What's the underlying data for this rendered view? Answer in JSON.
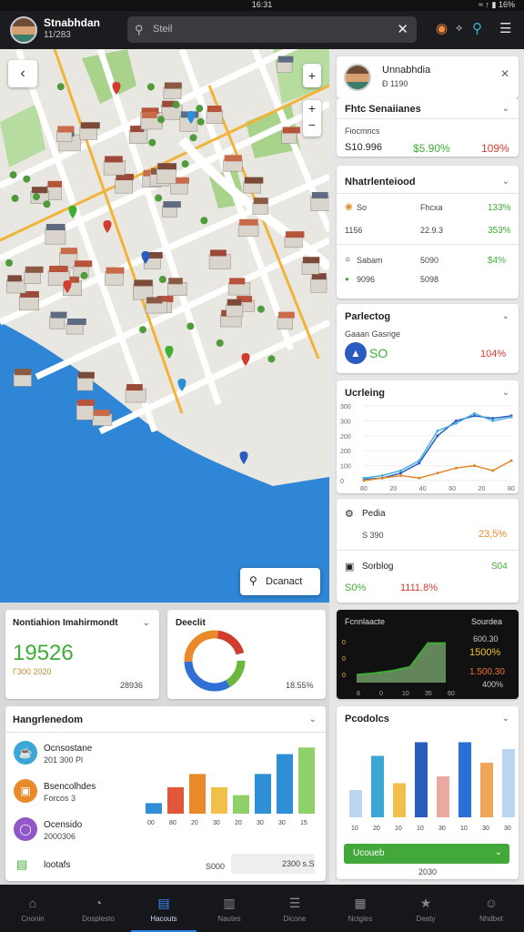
{
  "status_bar": {
    "time": "16:31",
    "icons": "≈ ↑ ▮ 16%"
  },
  "header": {
    "user_name": "Stnabhdan",
    "user_sub": "11/283",
    "search_placeholder": "Steil",
    "icons": [
      "alert-icon",
      "share-icon",
      "search-icon",
      "menu-icon"
    ]
  },
  "map": {
    "discover_label": "Dcanact",
    "zoom_in": "+",
    "zoom_out": "−",
    "layers": "+"
  },
  "profile_card": {
    "name": "Unnabhdia",
    "sub": "Ð 1190"
  },
  "stats_card": {
    "title": "Fhtc Senaiianes",
    "sub": "Fiocmncs",
    "v1": "S10.996",
    "v2": "$5.90%",
    "v3": "109%"
  },
  "notifications_card": {
    "title": "Nhatrlenteiood",
    "rows": [
      {
        "a": "So",
        "b": "Fhcxa",
        "c": "133%"
      },
      {
        "a": "1156",
        "b": "22.9.3",
        "c": "353%"
      },
      {
        "a": "Sabam",
        "b": "5090",
        "c": "$4%"
      },
      {
        "a": "9096",
        "b": "5098",
        "c": ""
      }
    ]
  },
  "parking_card": {
    "title": "Parlectog",
    "sub": "Gaaan Gasrige",
    "value": "SO",
    "pct": "104%"
  },
  "trending_card": {
    "title": "Ucrleing",
    "y_ticks": [
      "300",
      "300",
      "200",
      "200",
      "100",
      "0"
    ],
    "x_ticks": [
      "80",
      "20",
      "40",
      "60",
      "20",
      "80"
    ]
  },
  "finance_card": {
    "item1": "Pedia",
    "item1_value": "S 390",
    "item1_pct": "23,5%",
    "item2": "Sorblog",
    "item2_value": "S04",
    "row_a": "S0%",
    "row_b": "1111.8%"
  },
  "progress_card": {
    "title": "Fcnnlaacte",
    "right_title": "Sourdea",
    "values": [
      "600.30",
      "1500%",
      "1.500.30",
      "400%"
    ],
    "x_ticks": [
      "8",
      "0",
      "10",
      "35",
      "60"
    ]
  },
  "summary_card": {
    "title": "Nontiahion Imahirmondt",
    "value": "19526",
    "sub_left": "Γ300 2020",
    "sub_right": "28936"
  },
  "donut_card": {
    "title": "Deeclit",
    "pct": "18.55%"
  },
  "categories_card": {
    "title": "Hangrlenedom",
    "items": [
      {
        "name": "Ocnsostane",
        "sub": "201 300 Pl"
      },
      {
        "name": "Bsencolhdes",
        "sub": "Forcos 3"
      },
      {
        "name": "Ocensido",
        "sub": "2000306"
      },
      {
        "name": "lootafs",
        "sub": ""
      }
    ],
    "footer_a": "S000",
    "footer_b": "2300 s.S",
    "x_ticks": [
      "00",
      "80",
      "20",
      "30",
      "20",
      "30",
      "30",
      "15"
    ]
  },
  "products_card": {
    "title": "Pcodolcs",
    "button": "Ucoueb",
    "x_ticks": [
      "10",
      "20",
      "10",
      "10",
      "30",
      "10",
      "30",
      "30"
    ],
    "footer": "2030"
  },
  "bottom_nav": [
    {
      "label": "Cnonin",
      "icon": "home-icon"
    },
    {
      "label": "Dosplesto",
      "icon": "clock-icon"
    },
    {
      "label": "Hacouts",
      "icon": "map-icon"
    },
    {
      "label": "Nautes",
      "icon": "chart-icon"
    },
    {
      "label": "Dicone",
      "icon": "list-icon"
    },
    {
      "label": "Nctgles",
      "icon": "calendar-icon"
    },
    {
      "label": "Deaty",
      "icon": "star-icon"
    },
    {
      "label": "Nhdbet",
      "icon": "person-icon"
    }
  ],
  "chart_data": [
    {
      "type": "line",
      "title": "Ucrleing",
      "x": [
        0,
        10,
        20,
        30,
        40,
        50,
        60,
        70,
        80
      ],
      "series": [
        {
          "values": [
            5,
            10,
            30,
            70,
            180,
            240,
            260,
            250,
            260
          ]
        },
        {
          "values": [
            10,
            20,
            40,
            80,
            200,
            230,
            270,
            240,
            255
          ]
        },
        {
          "values": [
            0,
            10,
            20,
            10,
            30,
            50,
            60,
            40,
            80
          ]
        }
      ],
      "ylim": [
        0,
        300
      ]
    },
    {
      "type": "line",
      "title": "Fcnnlaacte",
      "x": [
        0,
        1,
        2,
        3,
        4,
        5
      ],
      "series": [
        {
          "values": [
            10,
            12,
            15,
            20,
            50,
            50
          ]
        }
      ],
      "ylim": [
        0,
        60
      ]
    },
    {
      "type": "bar",
      "title": "Hangrlenedom",
      "categories": [
        "1",
        "2",
        "3",
        "4",
        "5",
        "6",
        "7",
        "8"
      ],
      "values": [
        8,
        20,
        30,
        20,
        14,
        30,
        45,
        50
      ]
    },
    {
      "type": "bar",
      "title": "Pcodolcs",
      "categories": [
        "1",
        "2",
        "3",
        "4",
        "5",
        "6",
        "7",
        "8"
      ],
      "values": [
        20,
        45,
        25,
        55,
        30,
        55,
        40,
        50
      ]
    }
  ]
}
